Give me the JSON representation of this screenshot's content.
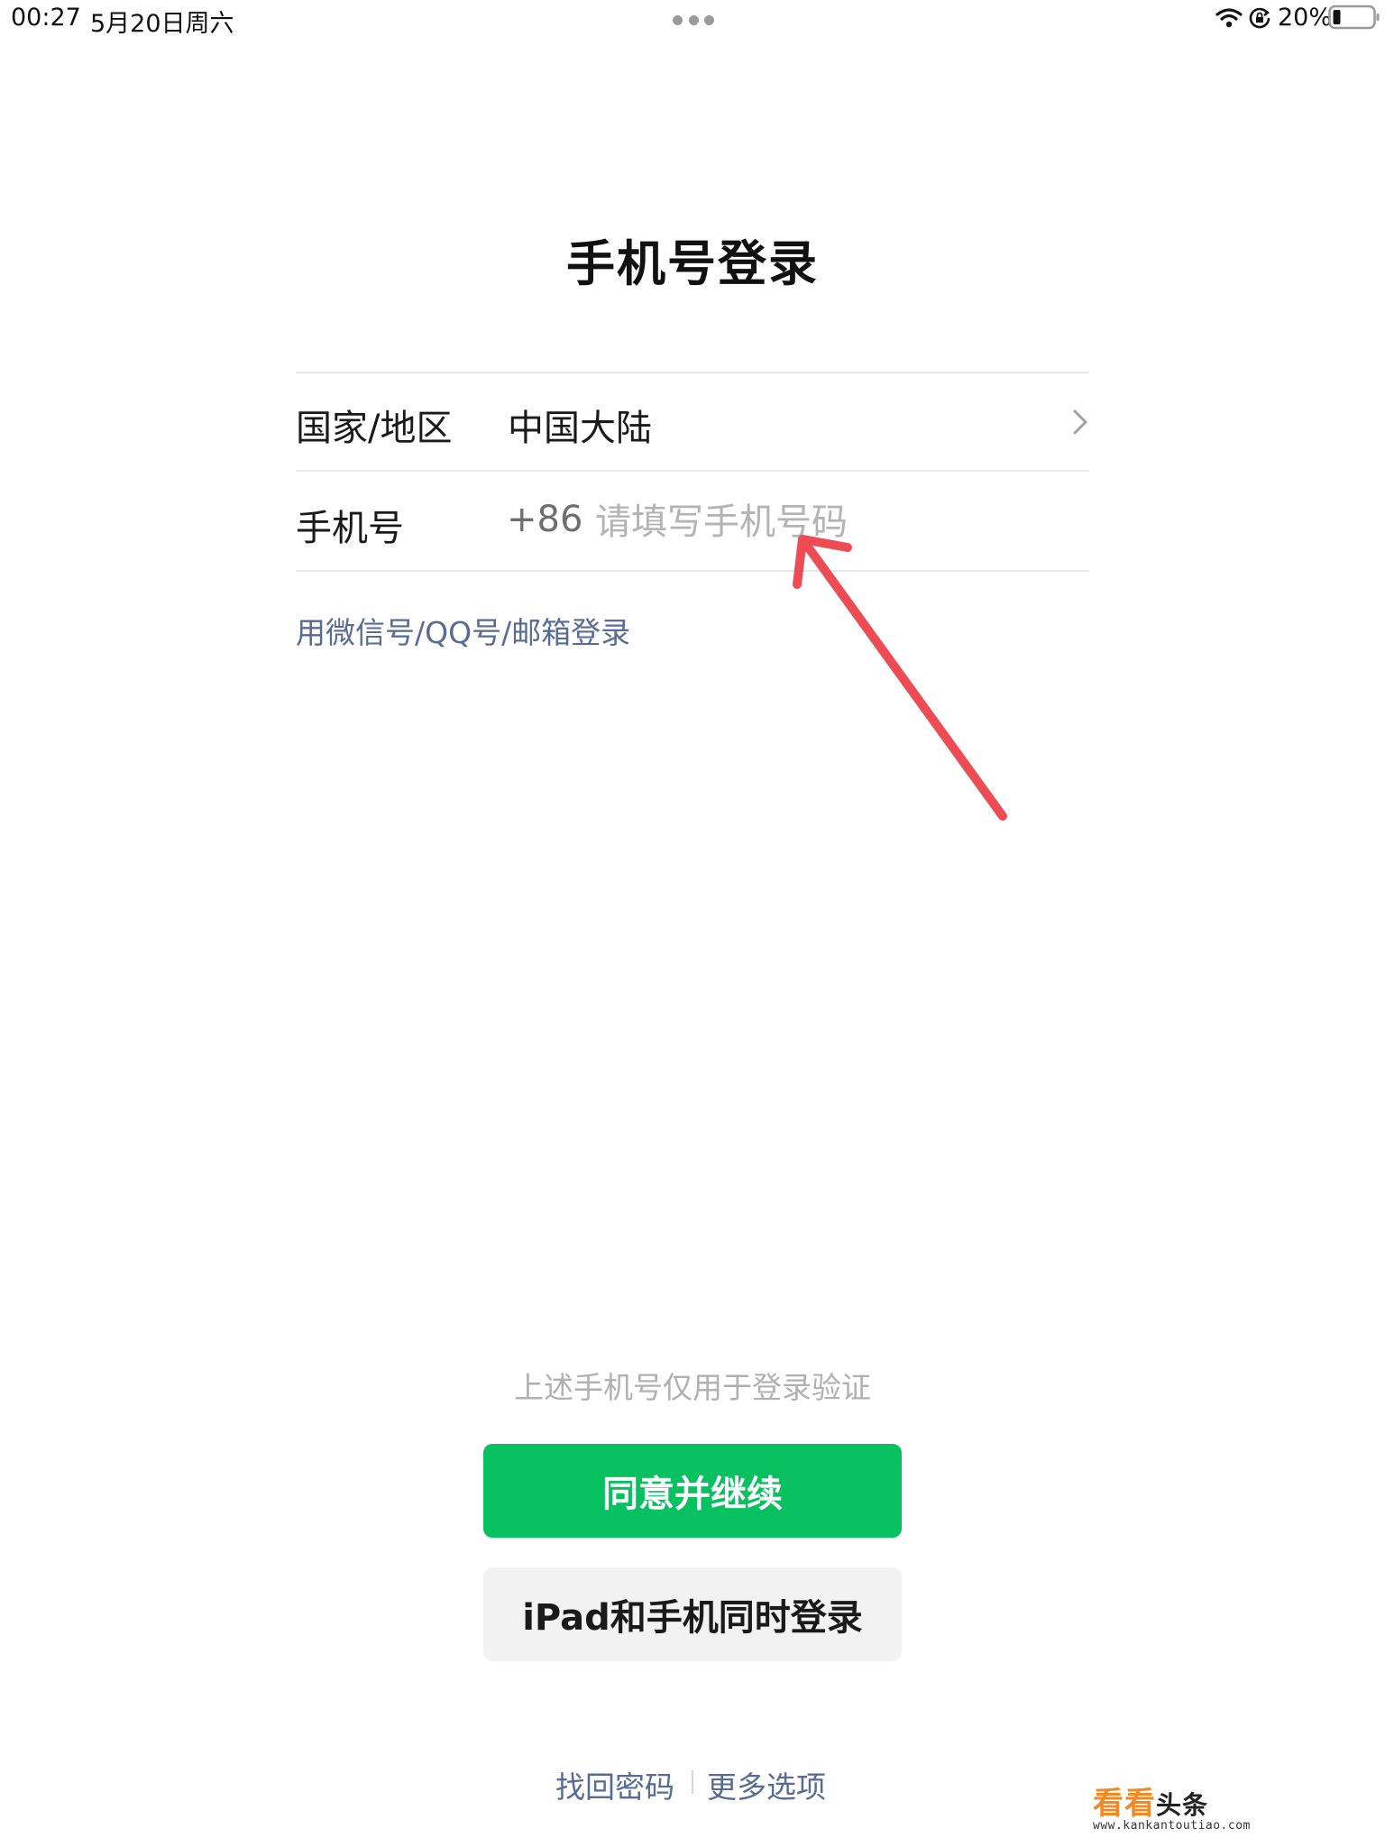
{
  "status_bar": {
    "time": "00:27",
    "date": "5月20日周六",
    "battery": "20%"
  },
  "title": "手机号登录",
  "form": {
    "country_label": "国家/地区",
    "country_value": "中国大陆",
    "phone_label": "手机号",
    "country_code": "+86",
    "phone_placeholder": "请填写手机号码",
    "phone_value": ""
  },
  "alt_login_link": "用微信号/QQ号/邮箱登录",
  "notice": "上述手机号仅用于登录验证",
  "buttons": {
    "agree": "同意并继续",
    "ipad_login": "iPad和手机同时登录"
  },
  "footer": {
    "recover_password": "找回密码",
    "more_options": "更多选项"
  },
  "watermark": {
    "logo": "看看头条",
    "url": "www.kankantoutiao.com"
  },
  "colors": {
    "primary_green": "#07c160",
    "link_blue": "#576b95",
    "annotation_red": "#ee4c55"
  },
  "icons": [
    "wifi-icon",
    "orientation-lock-icon",
    "battery-icon",
    "chevron-right-icon",
    "more-dots-icon"
  ]
}
